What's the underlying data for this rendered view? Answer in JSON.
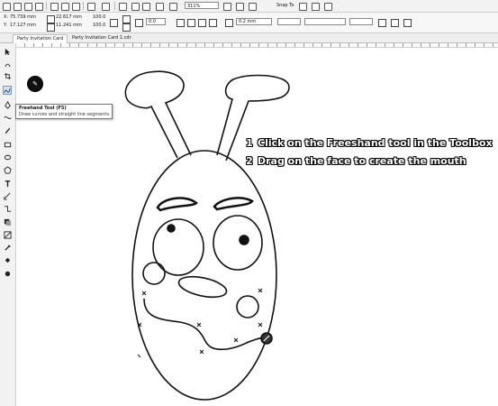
{
  "toolbar": {
    "zoom": "311%",
    "snap_label": "Snap To",
    "colors": {
      "highlight": "#cfe3f7"
    }
  },
  "propbar": {
    "x": "75.739 mm",
    "y": "17.127 mm",
    "w": "22.617 mm",
    "h": "11.241 mm",
    "sx": "100.0",
    "sy": "100.0",
    "angle": "0.0",
    "outline": "0.2 mm"
  },
  "tabs": [
    {
      "label": "Party Invitation Card"
    },
    {
      "label": "Party Invitation Card 1.cdr"
    }
  ],
  "tooltip": {
    "title": "Freehand Tool (F5)",
    "description": "Draw curves and straight line segments."
  },
  "instructions": [
    {
      "num": "1",
      "text": "Click on the Freeshand tool in the Toolbox"
    },
    {
      "num": "2",
      "text": "Drag on the face to create the mouth"
    }
  ]
}
